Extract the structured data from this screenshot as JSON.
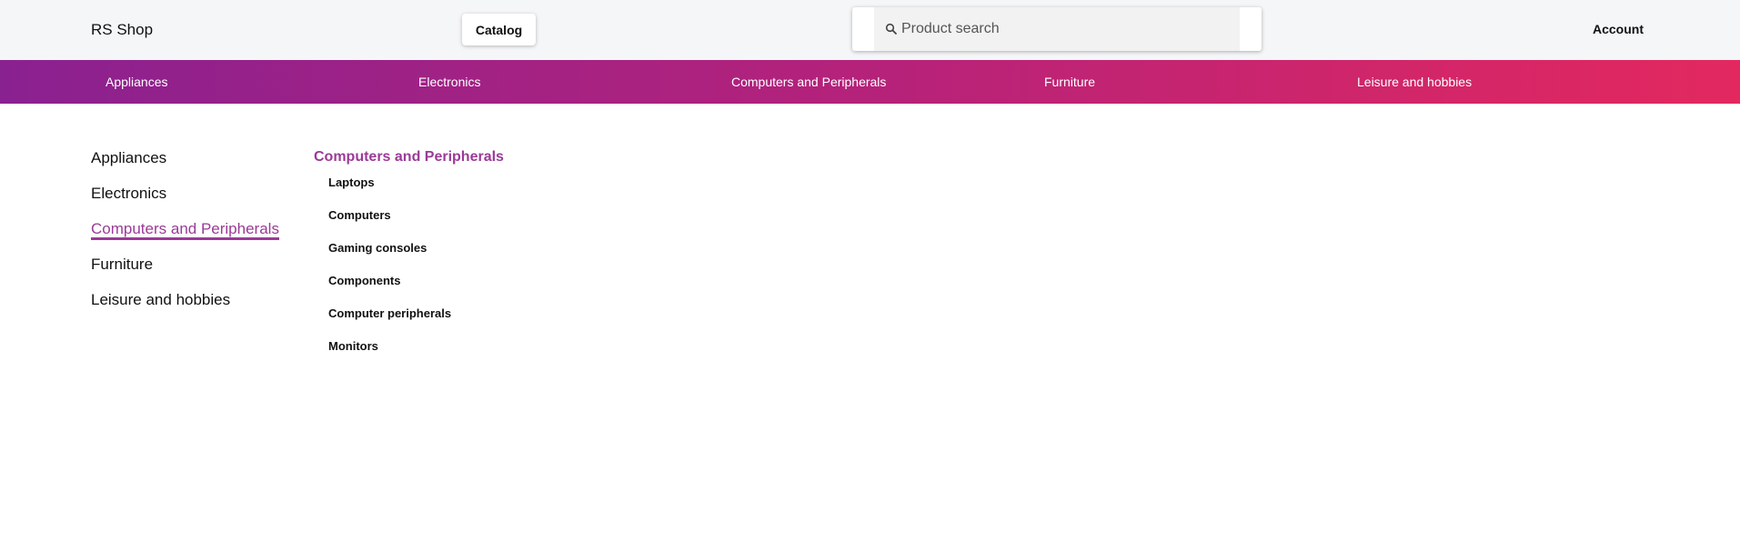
{
  "header": {
    "logo": "RS Shop",
    "catalog_label": "Catalog",
    "search_placeholder": "Product search",
    "search_value": "",
    "account_label": "Account",
    "icons": {
      "search": "search-icon"
    }
  },
  "navbar": {
    "items": [
      "Appliances",
      "Electronics",
      "Computers and Peripherals",
      "Furniture",
      "Leisure and hobbies"
    ],
    "gradient": [
      "#8a2190",
      "#e3285f"
    ]
  },
  "categories": {
    "items": [
      "Appliances",
      "Electronics",
      "Computers and Peripherals",
      "Furniture",
      "Leisure and hobbies"
    ],
    "active": "Computers and Peripherals",
    "active_color": "#9b3a97"
  },
  "subcategories": {
    "title": "Computers and Peripherals",
    "items": [
      "Laptops",
      "Computers",
      "Gaming consoles",
      "Components",
      "Computer peripherals",
      "Monitors"
    ]
  }
}
